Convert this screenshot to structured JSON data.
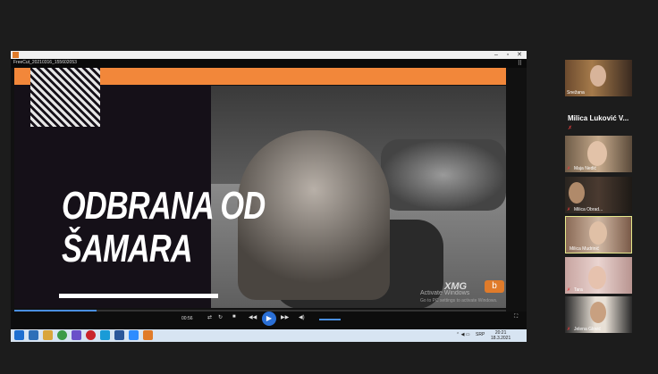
{
  "player": {
    "filename": "FreeCut_20210316_155602053",
    "time": "00:56",
    "watermark_line1": "Activate Windows",
    "watermark_line2": "Go to PC settings to activate Windows.",
    "logo_text": "XMG",
    "logo_mark": "b"
  },
  "slide": {
    "title_line1": "ODBRANA OD",
    "title_line2": "ŠAMARA"
  },
  "taskbar": {
    "lang": "SRP",
    "time": "20:21",
    "date": "18.3.2021"
  },
  "participants": {
    "top": {
      "name": "Snežana"
    },
    "speaker_name": "Milica Luković V...",
    "tiles": [
      {
        "name": "Maja Nedić"
      },
      {
        "name": "Milica Obrad..."
      },
      {
        "name": "Milica Mudrinić"
      },
      {
        "name": "Tara"
      },
      {
        "name": "Jelena Glović"
      }
    ]
  },
  "colors": {
    "accent": "#f2873a",
    "player_blue": "#2a6fd6",
    "active_tile_border": "#e6e88a"
  }
}
